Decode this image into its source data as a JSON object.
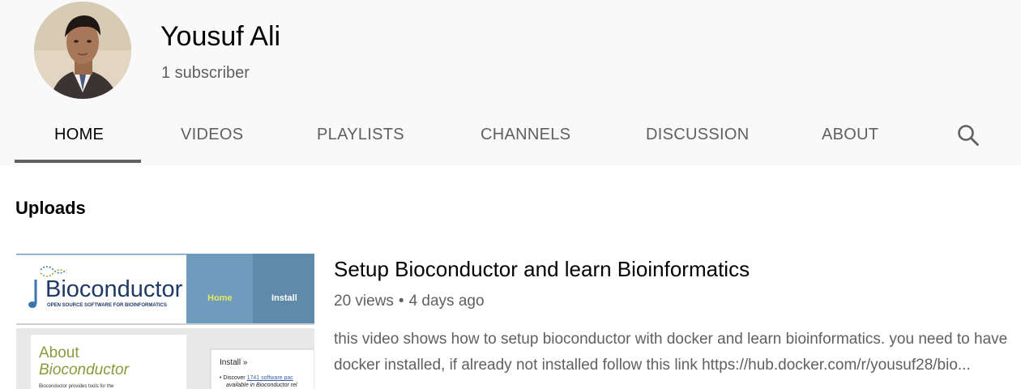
{
  "channel": {
    "name": "Yousuf Ali",
    "subscribers": "1 subscriber"
  },
  "tabs": [
    {
      "label": "HOME",
      "active": true
    },
    {
      "label": "VIDEOS",
      "active": false
    },
    {
      "label": "PLAYLISTS",
      "active": false
    },
    {
      "label": "CHANNELS",
      "active": false
    },
    {
      "label": "DISCUSSION",
      "active": false
    },
    {
      "label": "ABOUT",
      "active": false
    }
  ],
  "search_icon": "search-icon",
  "section": {
    "title": "Uploads"
  },
  "video": {
    "title": "Setup Bioconductor and learn Bioinformatics",
    "views": "20 views",
    "separator": "•",
    "age": "4 days ago",
    "description_line1": "this video shows how to setup bioconductor with docker and learn bioinformatics. you need to have",
    "description_line2": "docker installed, if already not installed follow this link https://hub.docker.com/r/yousuf28/bio...",
    "thumbnail": {
      "logo_text": "Bioconductor",
      "tagline": "OPEN SOURCE SOFTWARE FOR BIOINFORMATICS",
      "nav_home": "Home",
      "nav_install": "Install",
      "about_line1": "About",
      "about_line2": "Bioconductor",
      "about_body": "Bioconductor provides tools for the",
      "install_heading": "Install »",
      "install_bullet": "Discover",
      "install_link": "1741 software pac",
      "install_line2": "available in Bioconductor rel"
    }
  },
  "colors": {
    "header_bg": "#f9f9f9",
    "text_primary": "#030303",
    "text_secondary": "#606060",
    "thumb_nav": "#6f9bbc",
    "thumb_green": "#8a9a3a"
  }
}
